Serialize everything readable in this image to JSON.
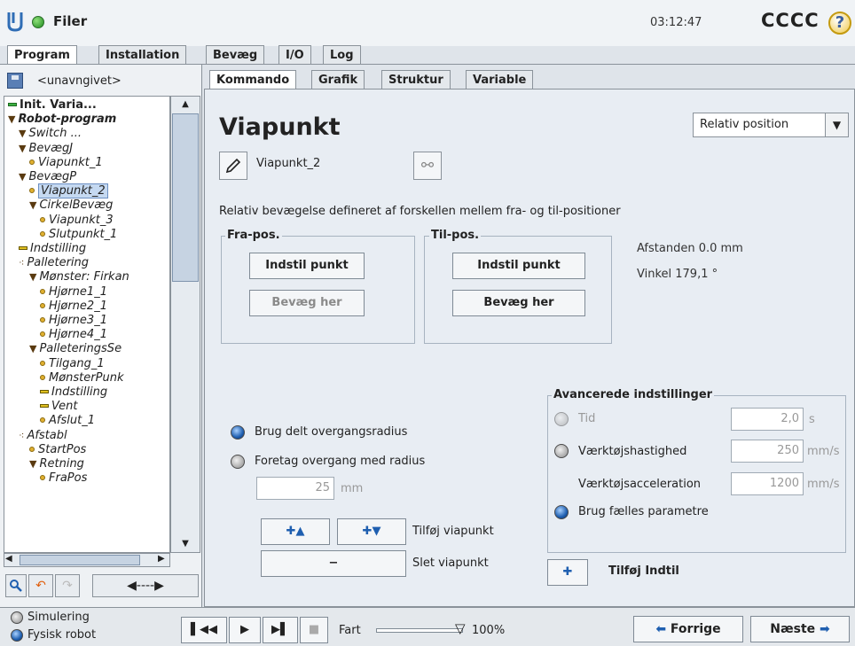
{
  "header": {
    "file_label": "Filer",
    "clock": "03:12:47",
    "robot_name": "CCCC",
    "help_symbol": "?"
  },
  "main_tabs": [
    "Program",
    "Installation",
    "Bevæg",
    "I/O",
    "Log"
  ],
  "program_file": "<unavngivet>",
  "tree": [
    {
      "label": "Init. Varia...",
      "icon": "bar-green",
      "bold": true,
      "italic": false,
      "indent": 0
    },
    {
      "label": "Robot-program",
      "icon": "triangle",
      "bold": true,
      "indent": 0
    },
    {
      "label": "Switch ...",
      "icon": "triangle",
      "indent": 1
    },
    {
      "label": "BevægJ",
      "icon": "triangle",
      "indent": 1
    },
    {
      "label": "Viapunkt_1",
      "icon": "dot",
      "indent": 2
    },
    {
      "label": "BevægP",
      "icon": "triangle",
      "indent": 1
    },
    {
      "label": "Viapunkt_2",
      "icon": "dot",
      "indent": 2,
      "selected": true
    },
    {
      "label": "CirkelBevæg",
      "icon": "triangle",
      "indent": 2
    },
    {
      "label": "Viapunkt_3",
      "icon": "dot",
      "indent": 3
    },
    {
      "label": "Slutpunkt_1",
      "icon": "dot",
      "indent": 3
    },
    {
      "label": "Indstilling",
      "icon": "bar",
      "indent": 1
    },
    {
      "label": "Palletering",
      "icon": "cluster",
      "indent": 1
    },
    {
      "label": "Mønster: Firkan",
      "icon": "triangle",
      "indent": 2
    },
    {
      "label": "Hjørne1_1",
      "icon": "dot",
      "indent": 3
    },
    {
      "label": "Hjørne2_1",
      "icon": "dot",
      "indent": 3
    },
    {
      "label": "Hjørne3_1",
      "icon": "dot",
      "indent": 3
    },
    {
      "label": "Hjørne4_1",
      "icon": "dot",
      "indent": 3
    },
    {
      "label": "PalleteringsSe",
      "icon": "triangle",
      "indent": 2
    },
    {
      "label": "Tilgang_1",
      "icon": "dot",
      "indent": 3
    },
    {
      "label": "MønsterPunk",
      "icon": "dot",
      "indent": 3
    },
    {
      "label": "Indstilling",
      "icon": "bar",
      "indent": 3
    },
    {
      "label": "Vent",
      "icon": "bar",
      "indent": 3
    },
    {
      "label": "Afslut_1",
      "icon": "dot",
      "indent": 3
    },
    {
      "label": "Afstabl",
      "icon": "cluster",
      "indent": 1
    },
    {
      "label": "StartPos",
      "icon": "dot",
      "indent": 2
    },
    {
      "label": "Retning",
      "icon": "triangle",
      "indent": 2
    },
    {
      "label": "FraPos",
      "icon": "dot",
      "indent": 3
    }
  ],
  "sub_tabs": [
    "Kommando",
    "Grafik",
    "Struktur",
    "Variable"
  ],
  "waypoint": {
    "title": "Viapunkt",
    "dropdown_value": "Relativ position",
    "name": "Viapunkt_2",
    "description": "Relativ bevægelse defineret af forskellen mellem fra- og til-positioner"
  },
  "from_group": {
    "title": "Fra-pos.",
    "set_point": "Indstil punkt",
    "move_here": "Bevæg her"
  },
  "to_group": {
    "title": "Til-pos.",
    "set_point": "Indstil punkt",
    "move_here": "Bevæg her"
  },
  "info": {
    "distance": "Afstanden 0.0 mm",
    "angle": "Vinkel 179,1 °"
  },
  "blend": {
    "shared_radius_label": "Brug delt overgangsradius",
    "blend_radius_label": "Foretag overgang med radius",
    "radius_value": "25",
    "radius_unit": "mm"
  },
  "waypoint_buttons": {
    "add_label": "Tilføj viapunkt",
    "delete_label": "Slet viapunkt",
    "minus_symbol": "−"
  },
  "advanced": {
    "title": "Avancerede indstillinger",
    "time_label": "Tid",
    "time_value": "2,0",
    "time_unit": "s",
    "tool_speed_label": "Værktøjshastighed",
    "tool_speed_value": "250",
    "tool_speed_unit": "mm/s",
    "tool_accel_label": "Værktøjsacceleration",
    "tool_accel_value": "1200",
    "tool_accel_unit": "mm/s",
    "common_params_label": "Brug fælles parametre"
  },
  "add_until_label": "Tilføj Indtil",
  "bottom": {
    "simulation_label": "Simulering",
    "real_robot_label": "Fysisk robot",
    "speed_label": "Fart",
    "speed_value": "100%",
    "speed_fraction": 1.0,
    "prev_label": "Forrige",
    "next_label": "Næste"
  },
  "colors": {
    "selected": "#c5d9f1",
    "accent_blue": "#1f5fb0",
    "active_green": "#1e8a1e"
  }
}
